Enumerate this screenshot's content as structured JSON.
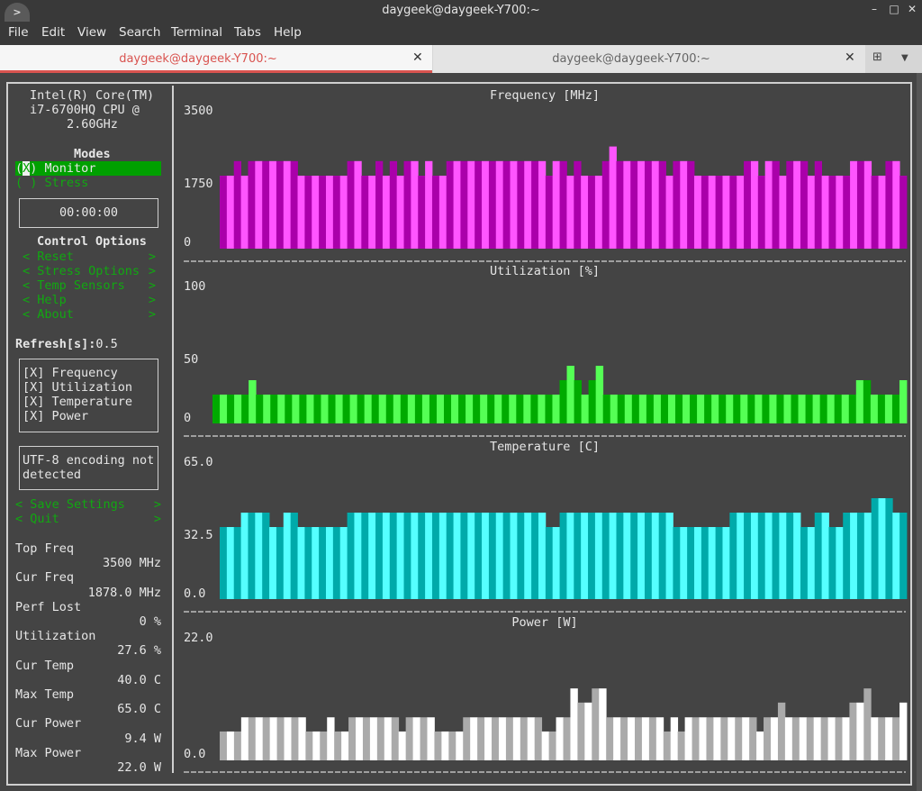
{
  "window": {
    "title": "daygeek@daygeek-Y700:~",
    "controls": [
      "minimize-icon",
      "maximize-icon",
      "close-icon"
    ]
  },
  "menubar": {
    "items": [
      "File",
      "Edit",
      "View",
      "Search",
      "Terminal",
      "Tabs",
      "Help"
    ]
  },
  "tabs": [
    {
      "label": "daygeek@daygeek-Y700:~",
      "active": true
    },
    {
      "label": "daygeek@daygeek-Y700:~",
      "active": false
    }
  ],
  "sidebar": {
    "cpu_name": [
      "Intel(R) Core(TM)",
      "i7-6700HQ CPU @",
      "2.60GHz"
    ],
    "modes_title": "Modes",
    "modes": [
      {
        "mark": "X",
        "label": "Monitor",
        "selected": true
      },
      {
        "mark": " ",
        "label": "Stress",
        "selected": false
      }
    ],
    "timer": "00:00:00",
    "control_title": "Control Options",
    "controls": [
      "Reset",
      "Stress Options",
      "Temp Sensors",
      "Help",
      "About"
    ],
    "refresh_label": "Refresh[s]:",
    "refresh_value": "0.5",
    "graph_toggles": [
      {
        "mark": "X",
        "label": "Frequency"
      },
      {
        "mark": "X",
        "label": "Utilization"
      },
      {
        "mark": "X",
        "label": "Temperature"
      },
      {
        "mark": "X",
        "label": "Power"
      }
    ],
    "encoding_msg": [
      "UTF-8 encoding not",
      "detected"
    ],
    "actions": [
      "Save Settings",
      "Quit"
    ],
    "stats": [
      {
        "label": "Top Freq",
        "value": "3500 MHz"
      },
      {
        "label": "Cur Freq",
        "value": "1878.0 MHz"
      },
      {
        "label": "Perf Lost",
        "value": "0 %"
      },
      {
        "label": "Utilization",
        "value": "27.6 %"
      },
      {
        "label": "Cur Temp",
        "value": "40.0 C"
      },
      {
        "label": "Max Temp",
        "value": "65.0 C"
      },
      {
        "label": "Cur Power",
        "value": "9.4 W"
      },
      {
        "label": "Max Power",
        "value": "22.0 W"
      }
    ]
  },
  "colors": {
    "freq": [
      "#ff55ff",
      "#aa00aa"
    ],
    "util": [
      "#55ff55",
      "#00aa00"
    ],
    "temp": [
      "#55ffff",
      "#00aaaa"
    ],
    "power": [
      "#ffffff",
      "#aaaaaa"
    ]
  },
  "chart_data": [
    {
      "type": "bar",
      "title": "Frequency [MHz]",
      "yticks": [
        "3500",
        "1750",
        "0"
      ],
      "ylim": [
        0,
        3500
      ],
      "values": [
        1750,
        1750,
        2100,
        1750,
        2100,
        2100,
        2100,
        2100,
        2100,
        2100,
        2100,
        1750,
        1750,
        1750,
        1750,
        1750,
        1750,
        1750,
        2100,
        2100,
        1750,
        1750,
        2100,
        1750,
        2100,
        1750,
        2100,
        2100,
        1750,
        2100,
        1750,
        1750,
        2100,
        2100,
        2100,
        2100,
        2100,
        2100,
        2100,
        2100,
        2100,
        2100,
        2100,
        2100,
        2100,
        2100,
        1750,
        2100,
        2100,
        1750,
        2100,
        1750,
        1750,
        1750,
        2100,
        2450,
        2100,
        2100,
        2100,
        2100,
        2100,
        2100,
        2100,
        1750,
        2100,
        2100,
        2100,
        1750,
        1750,
        1750,
        1750,
        1750,
        1750,
        1750,
        2100,
        2100,
        1750,
        2100,
        2100,
        1750,
        2100,
        2100,
        2100,
        1750,
        2100,
        1750,
        1750,
        1750,
        1750,
        2100,
        2100,
        2100,
        1750,
        1750,
        2100,
        2100,
        1750
      ]
    },
    {
      "type": "bar",
      "title": "Utilization [%]",
      "yticks": [
        "100",
        "50",
        "0"
      ],
      "ylim": [
        0,
        100
      ],
      "values": [
        20,
        20,
        20,
        20,
        20,
        30,
        20,
        20,
        20,
        20,
        20,
        20,
        20,
        20,
        20,
        20,
        20,
        20,
        20,
        20,
        20,
        20,
        20,
        20,
        20,
        20,
        20,
        20,
        20,
        20,
        20,
        20,
        20,
        20,
        20,
        20,
        20,
        20,
        20,
        20,
        20,
        20,
        20,
        20,
        20,
        20,
        20,
        20,
        30,
        40,
        30,
        20,
        30,
        40,
        20,
        20,
        20,
        20,
        20,
        20,
        20,
        20,
        20,
        20,
        20,
        20,
        20,
        20,
        20,
        20,
        20,
        20,
        20,
        20,
        20,
        20,
        20,
        20,
        20,
        20,
        20,
        20,
        20,
        20,
        20,
        20,
        20,
        20,
        20,
        30,
        30,
        20,
        20,
        20,
        20,
        30
      ]
    },
    {
      "type": "bar",
      "title": "Temperature [C]",
      "yticks": [
        "65.0",
        "32.5",
        "0.0"
      ],
      "ylim": [
        0,
        65
      ],
      "values": [
        32.5,
        32.5,
        32.5,
        39,
        39,
        39,
        39,
        32.5,
        32.5,
        39,
        39,
        32.5,
        32.5,
        32.5,
        32.5,
        32.5,
        32.5,
        32.5,
        39,
        39,
        39,
        39,
        39,
        39,
        39,
        39,
        39,
        39,
        39,
        39,
        39,
        39,
        39,
        39,
        39,
        39,
        39,
        39,
        39,
        39,
        39,
        39,
        39,
        39,
        39,
        39,
        32.5,
        32.5,
        39,
        39,
        39,
        39,
        39,
        39,
        39,
        39,
        39,
        39,
        39,
        39,
        39,
        39,
        39,
        39,
        32.5,
        32.5,
        32.5,
        32.5,
        32.5,
        32.5,
        32.5,
        32.5,
        39,
        39,
        39,
        39,
        39,
        39,
        39,
        39,
        39,
        39,
        32.5,
        32.5,
        39,
        39,
        32.5,
        32.5,
        39,
        39,
        39,
        39,
        45.5,
        45.5,
        45.5,
        39,
        39
      ]
    },
    {
      "type": "bar",
      "title": "Power [W]",
      "yticks": [
        "22.0",
        "0.0"
      ],
      "ylim": [
        0,
        22
      ],
      "values": [
        4.9,
        4.9,
        4.9,
        7.3,
        7.3,
        7.3,
        7.3,
        7.3,
        7.3,
        7.3,
        7.3,
        7.3,
        4.9,
        4.9,
        4.9,
        7.3,
        4.9,
        4.9,
        7.3,
        7.3,
        7.3,
        7.3,
        7.3,
        7.3,
        7.3,
        4.9,
        7.3,
        7.3,
        7.3,
        7.3,
        4.9,
        4.9,
        4.9,
        4.9,
        7.3,
        7.3,
        7.3,
        7.3,
        7.3,
        7.3,
        7.3,
        7.3,
        7.3,
        7.3,
        7.3,
        4.9,
        4.9,
        7.3,
        7.3,
        12.2,
        9.8,
        9.8,
        12.2,
        12.2,
        7.3,
        7.3,
        7.3,
        7.3,
        7.3,
        7.3,
        7.3,
        7.3,
        4.9,
        7.3,
        4.9,
        7.3,
        7.3,
        7.3,
        7.3,
        7.3,
        7.3,
        7.3,
        7.3,
        7.3,
        7.3,
        4.9,
        7.3,
        7.3,
        9.8,
        7.3,
        7.3,
        7.3,
        7.3,
        7.3,
        7.3,
        7.3,
        7.3,
        7.3,
        9.8,
        9.8,
        12.2,
        7.3,
        7.3,
        7.3,
        7.3,
        9.8
      ]
    }
  ]
}
